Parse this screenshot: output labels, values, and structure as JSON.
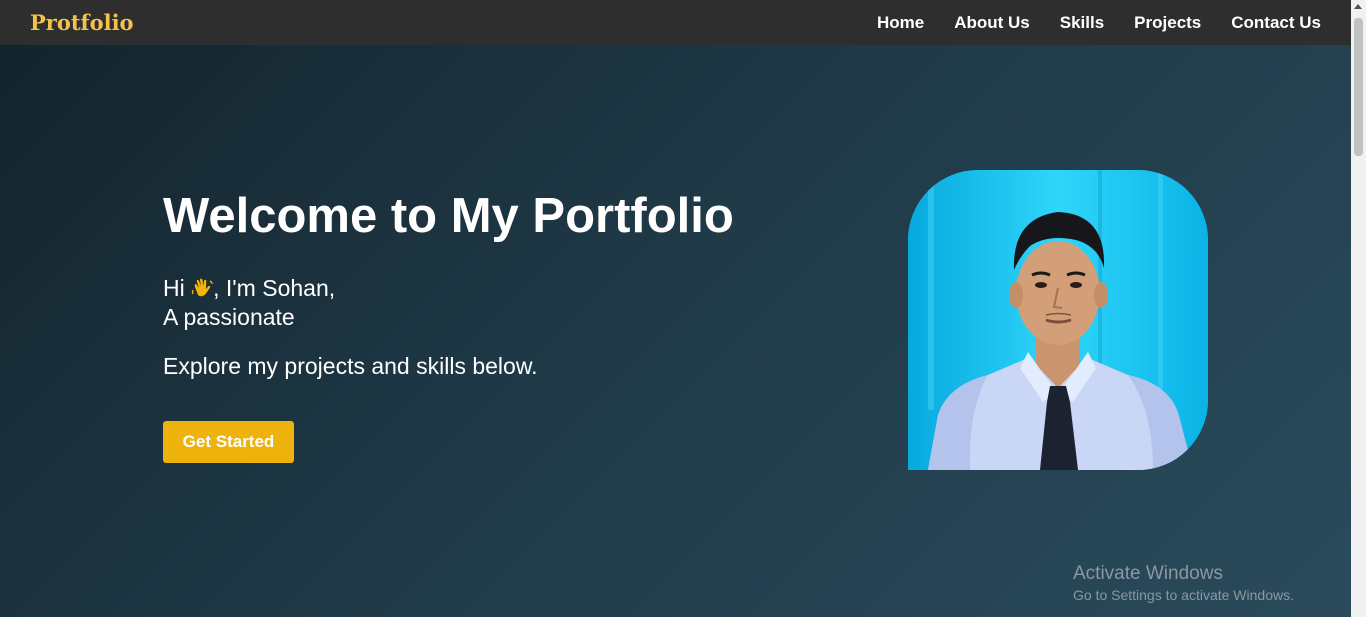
{
  "navbar": {
    "brand": "Protfolio",
    "links": [
      {
        "label": "Home"
      },
      {
        "label": "About Us"
      },
      {
        "label": "Skills"
      },
      {
        "label": "Projects"
      },
      {
        "label": "Contact Us"
      }
    ]
  },
  "hero": {
    "title": "Welcome to My Portfolio",
    "greeting_prefix": "Hi ",
    "greeting_icon": "waving-hand-icon",
    "greeting_suffix": ", I'm Sohan,",
    "tagline": "A passionate",
    "explore_text": "Explore my projects and skills below.",
    "cta_label": "Get Started",
    "photo": "profile-photo"
  },
  "watermark": {
    "title": "Activate Windows",
    "subtitle": "Go to Settings to activate Windows."
  },
  "colors": {
    "brand": "#f2c14e",
    "navbar_bg": "#2e2e2e",
    "cta_bg": "#edb20c",
    "photo_bg": "#0fc4f0"
  }
}
